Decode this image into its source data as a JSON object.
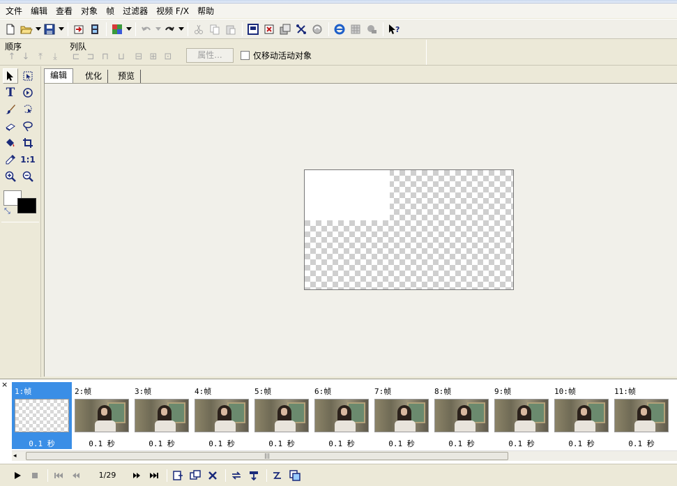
{
  "menu": [
    "文件",
    "编辑",
    "查看",
    "对象",
    "帧",
    "过滤器",
    "视频 F/X",
    "帮助"
  ],
  "propbar": {
    "order_label": "顺序",
    "queue_label": "列队",
    "attr_button": "属性...",
    "move_only_label": "仅移动活动对象",
    "move_only_checked": false
  },
  "tabs": [
    {
      "label": "编辑",
      "active": true
    },
    {
      "label": "优化",
      "active": false
    },
    {
      "label": "预览",
      "active": false
    }
  ],
  "tools": {
    "zoom_actual_label": "1:1",
    "text_tool_label": "T",
    "foreground_color": "#000000",
    "background_color": "#ffffff"
  },
  "frames": [
    {
      "label": "1:帧",
      "delay": "0.1 秒",
      "selected": true
    },
    {
      "label": "2:帧",
      "delay": "0.1 秒",
      "selected": false
    },
    {
      "label": "3:帧",
      "delay": "0.1 秒",
      "selected": false
    },
    {
      "label": "4:帧",
      "delay": "0.1 秒",
      "selected": false
    },
    {
      "label": "5:帧",
      "delay": "0.1 秒",
      "selected": false
    },
    {
      "label": "6:帧",
      "delay": "0.1 秒",
      "selected": false
    },
    {
      "label": "7:帧",
      "delay": "0.1 秒",
      "selected": false
    },
    {
      "label": "8:帧",
      "delay": "0.1 秒",
      "selected": false
    },
    {
      "label": "9:帧",
      "delay": "0.1 秒",
      "selected": false
    },
    {
      "label": "10:帧",
      "delay": "0.1 秒",
      "selected": false
    },
    {
      "label": "11:帧",
      "delay": "0.1 秒",
      "selected": false
    }
  ],
  "playbar": {
    "frame_counter": "1/29"
  },
  "colors": {
    "selection": "#3a8ee6",
    "chrome": "#ece9d8"
  }
}
